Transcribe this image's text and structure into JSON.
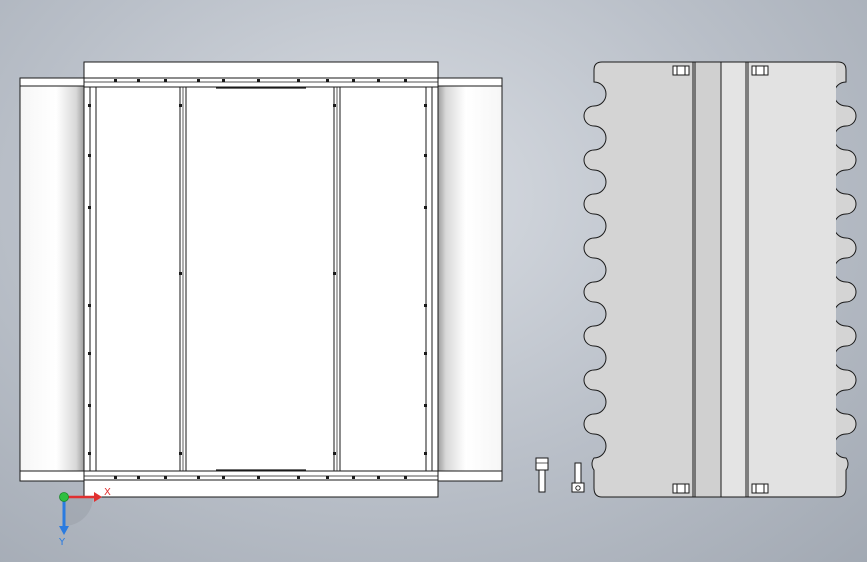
{
  "triad": {
    "x_label": "X",
    "y_label": "Y",
    "x_color": "#e03030",
    "y_color": "#2a7be0",
    "origin_color": "#2fc040"
  },
  "colors": {
    "background": "#b9bfc8",
    "line": "#1a1a1a",
    "part_white": "#ffffff",
    "panel_gray": "#d4d4d4",
    "panel_light": "#e2e2e2",
    "roller_shade": "#9a9a9a"
  }
}
